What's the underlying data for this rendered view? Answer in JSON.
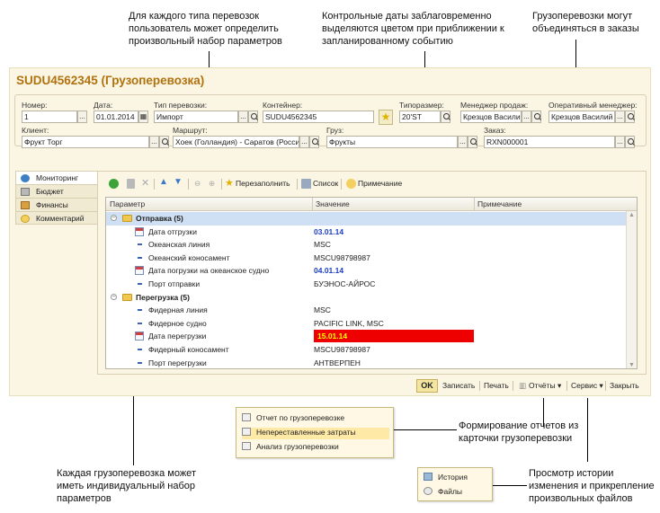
{
  "annotations": {
    "top_left": "Для каждого типа перевозок пользователь может определить произвольный набор параметров",
    "top_middle": "Контрольные даты заблаговременно выделяются цветом при приближении к запланированному событию",
    "top_right": "Грузоперевозки могут объединяться в заказы",
    "bottom_left": "Каждая грузоперевозка может иметь индивидуальный набор параметров",
    "bottom_middle": "Формирование отчетов из карточки грузоперевозки",
    "bottom_right": "Просмотр истории изменения и прикрепление произвольных файлов"
  },
  "window": {
    "title": "SUDU4562345 (Грузоперевозка)",
    "title_color": "#b0720e"
  },
  "fields": {
    "number_label": "Номер:",
    "number_value": "1",
    "date_label": "Дата:",
    "date_value": "01.01.2014",
    "type_label": "Тип перевозки:",
    "type_value": "Импорт",
    "container_label": "Контейнер:",
    "container_value": "SUDU4562345",
    "size_label": "Типоразмер:",
    "size_value": "20'ST",
    "sales_manager_label": "Менеджер продаж:",
    "sales_manager_value": "Крезцов Василий",
    "op_manager_label": "Оперативный менеджер:",
    "op_manager_value": "Крезцов Василий",
    "client_label": "Клиент:",
    "client_value": "Фрукт Торг",
    "route_label": "Маршрут:",
    "route_value": "Хоек (Голландия) - Саратов (Росси",
    "cargo_label": "Груз:",
    "cargo_value": "Фрукты",
    "order_label": "Заказ:",
    "order_value": "RXN000001"
  },
  "tabs": [
    {
      "label": "Мониторинг",
      "icon": "globe-icon"
    },
    {
      "label": "Бюджет",
      "icon": "calculator-icon"
    },
    {
      "label": "Финансы",
      "icon": "money-icon"
    },
    {
      "label": "Комментарий",
      "icon": "comment-icon"
    }
  ],
  "toolbar": {
    "refill": "Перезаполнить",
    "list": "Список",
    "note": "Примечание"
  },
  "grid": {
    "headers": {
      "param": "Параметр",
      "value": "Значение",
      "note": "Примечание"
    },
    "rows": [
      {
        "kind": "group",
        "name": "Отправка (5)",
        "value": ""
      },
      {
        "kind": "date",
        "name": "Дата отгрузки",
        "value": "03.01.14",
        "style": "blue"
      },
      {
        "kind": "item",
        "name": "Океанская линия",
        "value": "MSC"
      },
      {
        "kind": "item",
        "name": "Океанский коносамент",
        "value": "MSCU98798987"
      },
      {
        "kind": "date",
        "name": "Дата погрузки на океанское судно",
        "value": "04.01.14",
        "style": "blue"
      },
      {
        "kind": "item",
        "name": "Порт отправки",
        "value": "БУЭНОС-АЙРОС"
      },
      {
        "kind": "group",
        "name": "Перегрузка (5)",
        "value": ""
      },
      {
        "kind": "item",
        "name": "Фидерная линия",
        "value": "MSC"
      },
      {
        "kind": "item",
        "name": "Фидерное судно",
        "value": "PACIFIC LINK, MSC"
      },
      {
        "kind": "date",
        "name": "Дата перегрузки",
        "value": "15.01.14",
        "style": "red"
      },
      {
        "kind": "item",
        "name": "Фидерный коносамент",
        "value": "MSCU98798987"
      },
      {
        "kind": "item",
        "name": "Порт перегрузки",
        "value": "АНТВЕРПЕН"
      }
    ]
  },
  "bottom_bar": {
    "ok": "OK",
    "save": "Записать",
    "print": "Печать",
    "reports": "Отчёты",
    "service": "Сервис",
    "close": "Закрыть"
  },
  "reports_menu": [
    "Отчет по грузоперевозке",
    "Непереставленные затраты",
    "Анализ грузоперевозки"
  ],
  "service_menu": [
    "История",
    "Файлы"
  ]
}
